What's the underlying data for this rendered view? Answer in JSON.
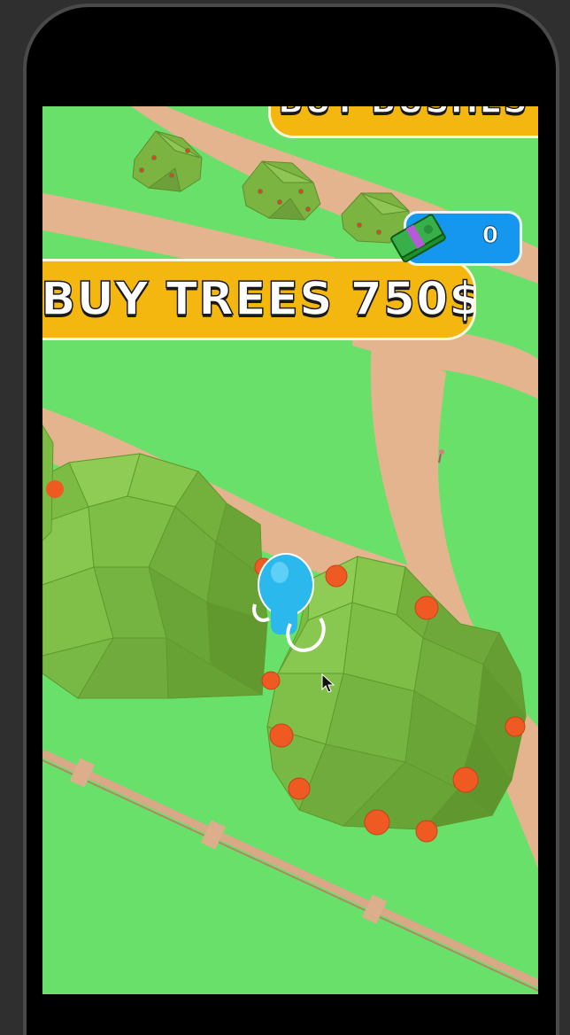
{
  "hud": {
    "top_banner_text": "BUY BUSHES",
    "buy_trees_label": "BUY TREES 750$",
    "money_value": "0",
    "money_icon": "cash-stack-icon",
    "cursor_icon": "mouse-pointer-icon"
  },
  "colors": {
    "grass": "#68e06a",
    "path": "#e4b48e",
    "banner": "#f4b710",
    "money_panel": "#1597f0",
    "tree": "#7cc042",
    "fruit": "#ef5a22",
    "player": "#2bb8ec"
  }
}
